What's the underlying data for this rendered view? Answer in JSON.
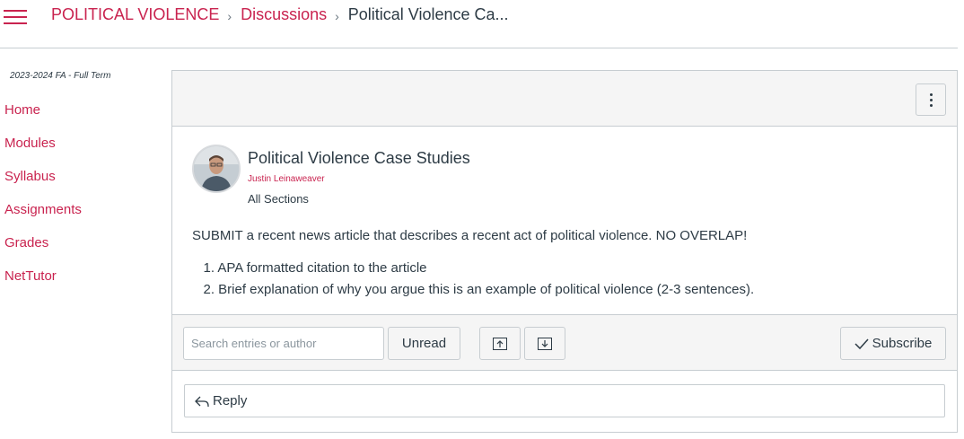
{
  "header": {
    "breadcrumb": {
      "course": "POLITICAL VIOLENCE",
      "section": "Discussions",
      "current": "Political Violence Ca..."
    }
  },
  "sidebar": {
    "term": "2023-2024 FA - Full Term",
    "items": [
      {
        "label": "Home"
      },
      {
        "label": "Modules"
      },
      {
        "label": "Syllabus"
      },
      {
        "label": "Assignments"
      },
      {
        "label": "Grades"
      },
      {
        "label": "NetTutor"
      }
    ]
  },
  "post": {
    "title": "Political Violence Case Studies",
    "author": "Justin Leinaweaver",
    "sections": "All Sections",
    "body": "SUBMIT a recent news article that describes a recent act of political violence. NO OVERLAP!",
    "list": [
      {
        "num": "1.",
        "text": "APA formatted citation to the article"
      },
      {
        "num": "2.",
        "text": "Brief explanation of why you argue this is an example of political violence (2-3 sentences)."
      }
    ]
  },
  "toolbar": {
    "search_placeholder": "Search entries or author",
    "unread_label": "Unread",
    "subscribe_label": "Subscribe"
  },
  "reply": {
    "label": "Reply"
  },
  "colors": {
    "accent": "#c9234f",
    "text": "#2d3b45",
    "border": "#c7cdd1",
    "panel_bg": "#f5f5f5"
  },
  "icons": {
    "menu": "hamburger-icon",
    "breadcrumb_separator": "chevron-right-icon",
    "options": "kebab-menu-icon",
    "expand": "collapse-up-icon",
    "collapse": "expand-down-icon",
    "subscribe": "checkmark-icon",
    "reply": "reply-arrow-icon"
  }
}
